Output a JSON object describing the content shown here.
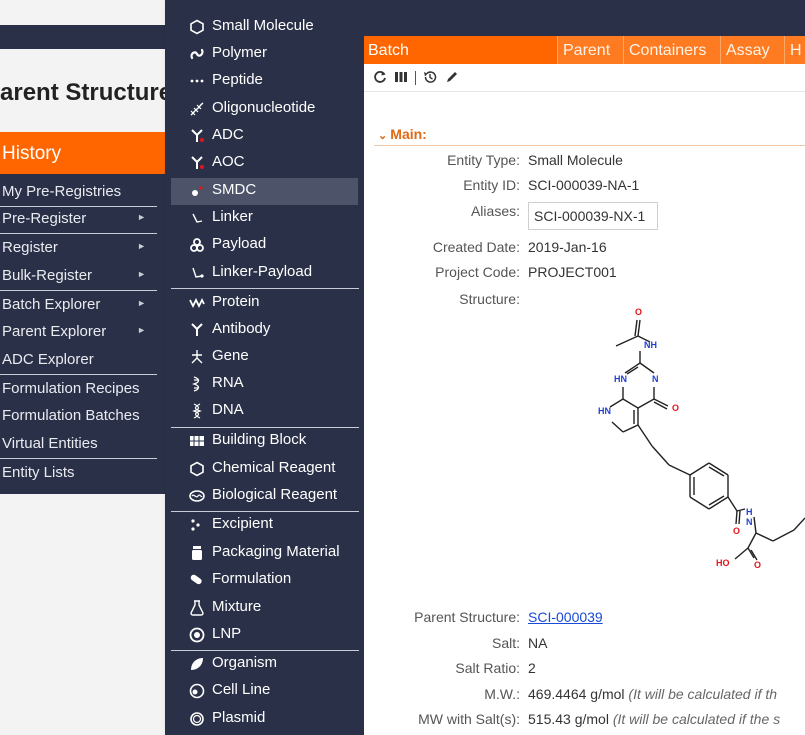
{
  "left": {
    "page_title": "arent Structure",
    "menu_header": "History",
    "items": [
      {
        "label": "My Pre-Registries",
        "arrow": ""
      },
      {
        "label": "Pre-Register",
        "arrow": "►"
      },
      {
        "label": "Register",
        "arrow": "►"
      },
      {
        "label": "Bulk-Register",
        "arrow": "►"
      },
      {
        "label": "Batch Explorer",
        "arrow": "►"
      },
      {
        "label": "Parent Explorer",
        "arrow": "►"
      },
      {
        "label": "ADC Explorer",
        "arrow": ""
      },
      {
        "label": "Formulation Recipes",
        "arrow": ""
      },
      {
        "label": "Formulation Batches",
        "arrow": ""
      },
      {
        "label": "Virtual Entities",
        "arrow": ""
      },
      {
        "label": "Entity Lists",
        "arrow": ""
      }
    ]
  },
  "dropdown": {
    "items": [
      {
        "label": "Small Molecule",
        "icon": "hexagon-icon"
      },
      {
        "label": "Polymer",
        "icon": "polymer-icon"
      },
      {
        "label": "Peptide",
        "icon": "peptide-icon"
      },
      {
        "label": "Oligonucleotide",
        "icon": "oligonucleotide-icon"
      },
      {
        "label": "ADC",
        "icon": "adc-icon"
      },
      {
        "label": "AOC",
        "icon": "aoc-icon"
      },
      {
        "label": "SMDC",
        "icon": "smdc-icon",
        "highlighted": true
      },
      {
        "label": "Linker",
        "icon": "linker-icon"
      },
      {
        "label": "Payload",
        "icon": "payload-icon"
      },
      {
        "label": "Linker-Payload",
        "icon": "linker-payload-icon"
      },
      {
        "label": "Protein",
        "icon": "protein-icon"
      },
      {
        "label": "Antibody",
        "icon": "antibody-icon"
      },
      {
        "label": "Gene",
        "icon": "gene-icon"
      },
      {
        "label": "RNA",
        "icon": "rna-icon"
      },
      {
        "label": "DNA",
        "icon": "dna-icon"
      },
      {
        "label": "Building Block",
        "icon": "building-block-icon"
      },
      {
        "label": "Chemical Reagent",
        "icon": "chemical-reagent-icon"
      },
      {
        "label": "Biological Reagent",
        "icon": "biological-reagent-icon"
      },
      {
        "label": "Excipient",
        "icon": "excipient-icon"
      },
      {
        "label": "Packaging Material",
        "icon": "packaging-material-icon"
      },
      {
        "label": "Formulation",
        "icon": "formulation-icon"
      },
      {
        "label": "Mixture",
        "icon": "mixture-icon"
      },
      {
        "label": "LNP",
        "icon": "lnp-icon"
      },
      {
        "label": "Organism",
        "icon": "organism-icon"
      },
      {
        "label": "Cell Line",
        "icon": "cell-line-icon"
      },
      {
        "label": "Plasmid",
        "icon": "plasmid-icon"
      }
    ]
  },
  "tabs": {
    "active": "Batch",
    "others": [
      "Parent",
      "Containers",
      "Assay",
      "H"
    ]
  },
  "main": {
    "section_title": "Main:",
    "entity_type_label": "Entity Type:",
    "entity_type": "Small Molecule",
    "entity_id_label": "Entity ID:",
    "entity_id": "SCI-000039-NA-1",
    "aliases_label": "Aliases:",
    "aliases": "SCI-000039-NX-1",
    "created_date_label": "Created Date:",
    "created_date": "2019-Jan-16",
    "project_code_label": "Project Code:",
    "project_code": "PROJECT001",
    "structure_label": "Structure:",
    "parent_structure_label": "Parent Structure:",
    "parent_structure": "SCI-000039",
    "salt_label": "Salt:",
    "salt": "NA",
    "salt_ratio_label": "Salt Ratio:",
    "salt_ratio": "2",
    "mw_label": "M.W.:",
    "mw_value": "469.4464 g/mol",
    "mw_note": "(It will be calculated if th",
    "mw_salt_label": "MW with Salt(s):",
    "mw_salt_value": "515.43 g/mol",
    "mw_salt_note": "(It will be calculated if the s"
  },
  "structure_atoms": {
    "o1": "O",
    "nh1": "NH",
    "hn": "HN",
    "n": "N",
    "o2": "O",
    "hn2": "HN",
    "n_amide": "N",
    "h_amide": "H",
    "o3": "O",
    "ho": "HO",
    "o4": "O"
  },
  "colors": {
    "navy": "#2a3047",
    "orange": "#ff6600",
    "orange_tab": "#ff7b22",
    "highlight": "#4d5368",
    "link": "#1a4bd6",
    "nitrogen": "#1f3fd6",
    "oxygen": "#e4141b"
  }
}
